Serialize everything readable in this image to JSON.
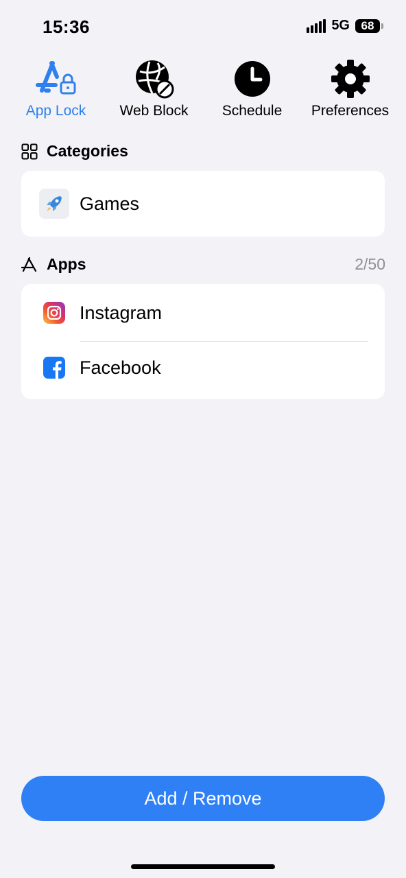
{
  "status_bar": {
    "time": "15:36",
    "network": "5G",
    "battery": "68"
  },
  "tabs": [
    {
      "label": "App Lock",
      "icon": "app-store-lock-icon",
      "active": true
    },
    {
      "label": "Web Block",
      "icon": "globe-block-icon",
      "active": false
    },
    {
      "label": "Schedule",
      "icon": "clock-icon",
      "active": false
    },
    {
      "label": "Preferences",
      "icon": "gear-icon",
      "active": false
    }
  ],
  "categories": {
    "title": "Categories",
    "icon": "grid-icon",
    "items": [
      {
        "label": "Games",
        "icon": "rocket-icon"
      }
    ]
  },
  "apps": {
    "title": "Apps",
    "icon": "app-store-icon",
    "count": "2/50",
    "items": [
      {
        "label": "Instagram",
        "icon": "instagram-icon"
      },
      {
        "label": "Facebook",
        "icon": "facebook-icon"
      }
    ]
  },
  "footer": {
    "button_label": "Add / Remove"
  },
  "colors": {
    "accent": "#2f80ed",
    "background": "#f2f2f7",
    "card": "#ffffff",
    "muted": "#8e8e93",
    "facebook": "#1877f2"
  }
}
